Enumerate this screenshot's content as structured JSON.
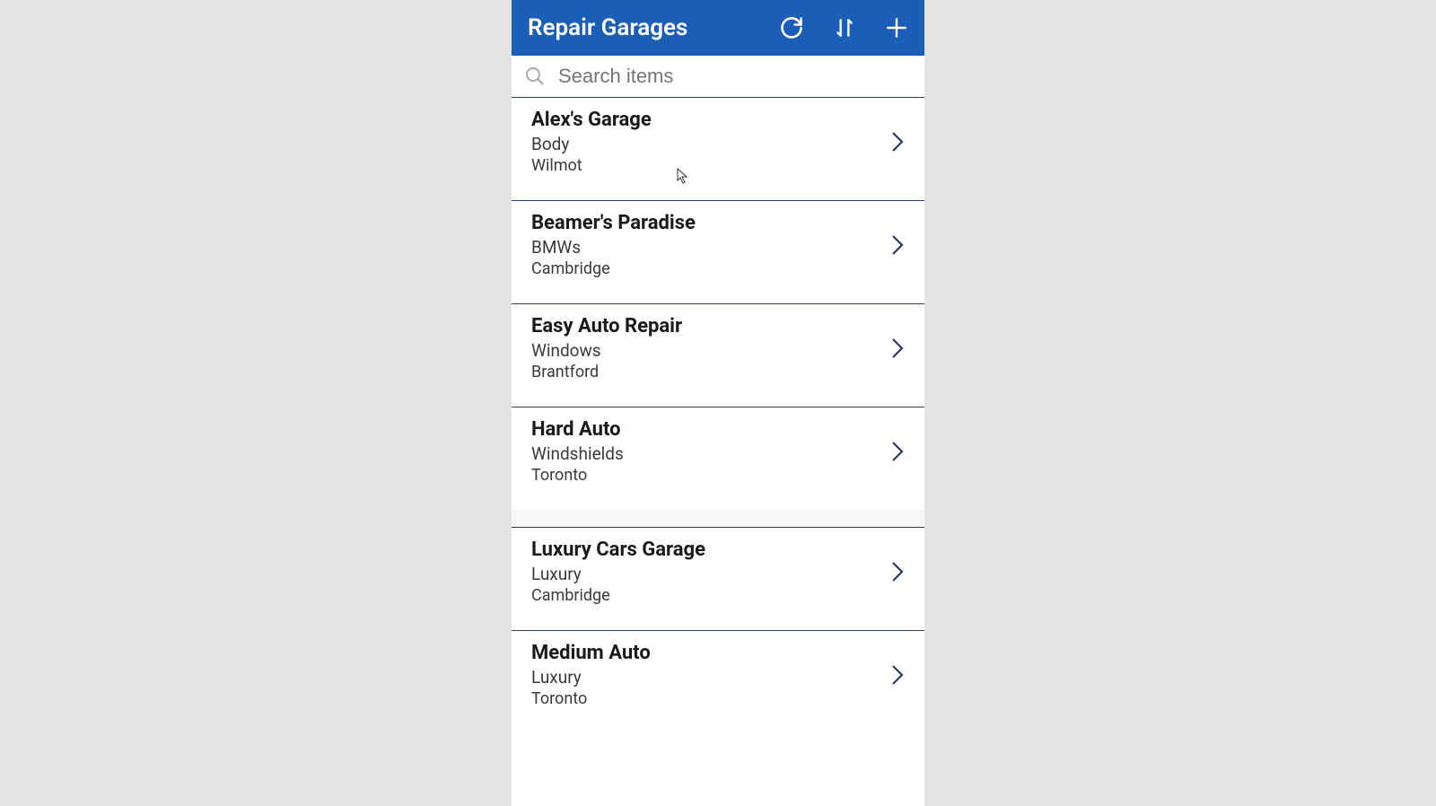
{
  "header": {
    "title": "Repair Garages"
  },
  "search": {
    "placeholder": "Search items"
  },
  "colors": {
    "headerBg": "#1a5eb8",
    "chevron": "#1a2f66"
  },
  "items": [
    {
      "name": "Alex's Garage",
      "specialty": "Body",
      "location": "Wilmot"
    },
    {
      "name": "Beamer's Paradise",
      "specialty": "BMWs",
      "location": "Cambridge"
    },
    {
      "name": "Easy Auto Repair",
      "specialty": "Windows",
      "location": "Brantford"
    },
    {
      "name": "Hard Auto",
      "specialty": "Windshields",
      "location": "Toronto"
    },
    {
      "name": "Luxury Cars Garage",
      "specialty": "Luxury",
      "location": "Cambridge"
    },
    {
      "name": "Medium Auto",
      "specialty": "Luxury",
      "location": "Toronto"
    }
  ]
}
